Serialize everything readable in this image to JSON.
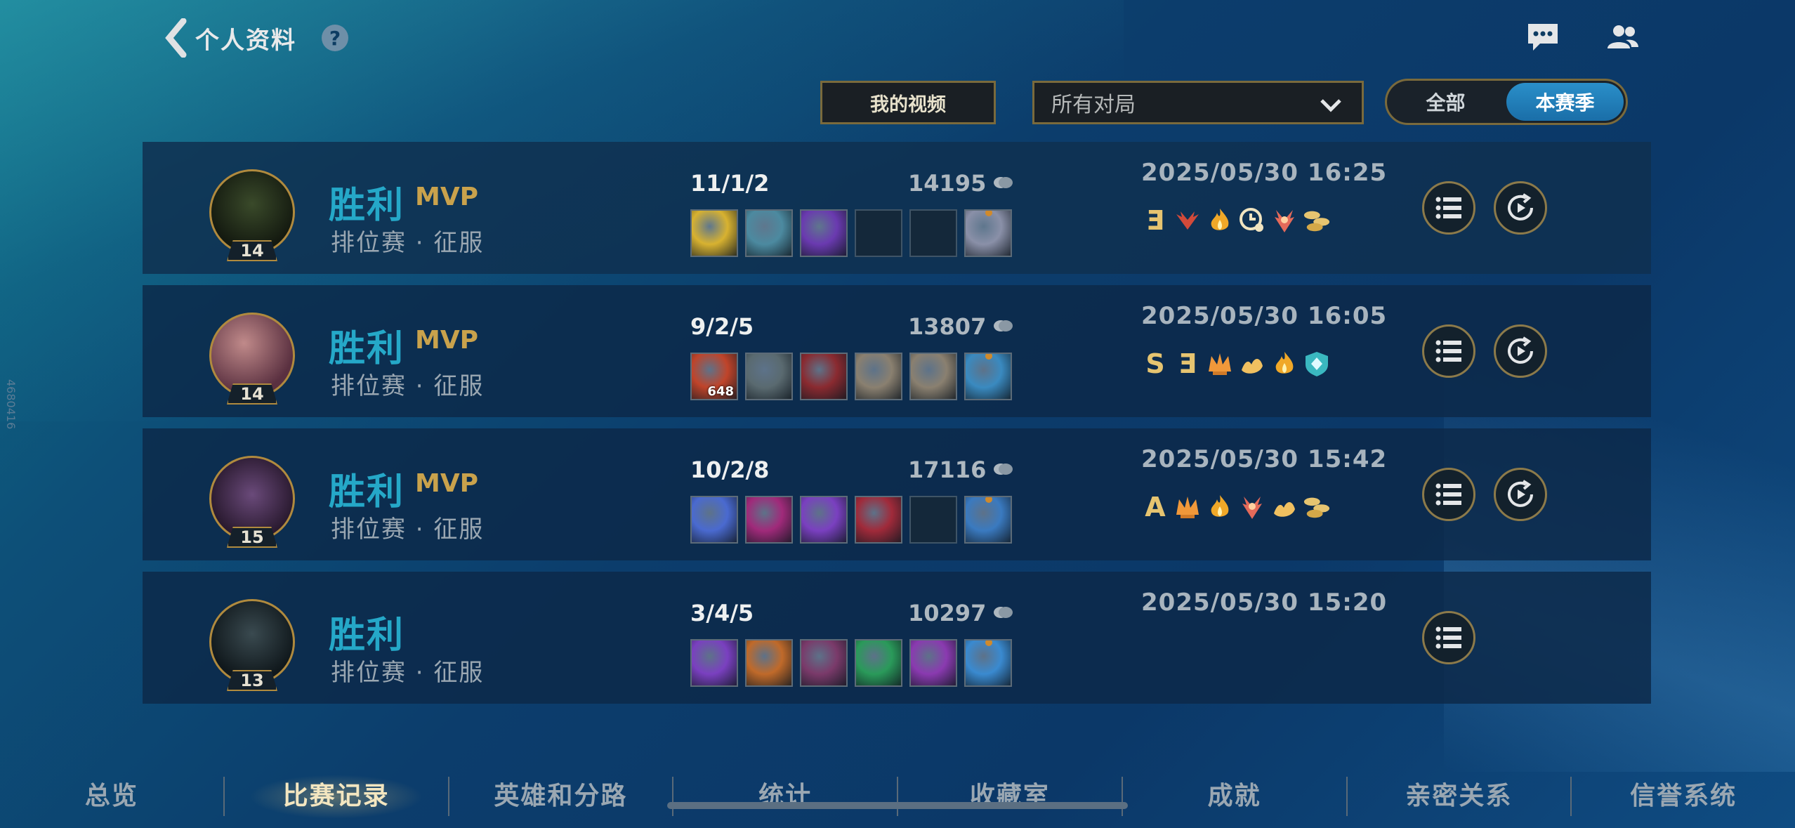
{
  "header": {
    "title": "个人资料",
    "help": "?"
  },
  "filters": {
    "videos_label": "我的视频",
    "match_type_selected": "所有对局",
    "season_options": [
      "全部",
      "本赛季"
    ],
    "season_selected": "本赛季"
  },
  "side_label": "4680416",
  "matches": [
    {
      "level": "14",
      "result": "胜利",
      "mvp": "MVP",
      "mode": "排位赛 · 征服",
      "kda": "11/1/2",
      "gold": "14195",
      "date": "2025/05/30 16:25",
      "badges": [
        "Ǝ",
        "wings",
        "flame",
        "clock",
        "wings2",
        "coins"
      ],
      "items": [
        {
          "color": "#d8b230"
        },
        {
          "color": "#4c8aa0"
        },
        {
          "color": "#6a3ab0"
        },
        {
          "color": ""
        },
        {
          "color": ""
        },
        {
          "color": "#8a90a8"
        }
      ]
    },
    {
      "level": "14",
      "result": "胜利",
      "mvp": "MVP",
      "mode": "排位赛 · 征服",
      "kda": "9/2/5",
      "gold": "13807",
      "date": "2025/05/30 16:05",
      "badges": [
        "S",
        "Ǝ",
        "crown",
        "hands",
        "flame",
        "shield"
      ],
      "items": [
        {
          "color": "#c0442a",
          "count": "648"
        },
        {
          "color": "#5a6a70"
        },
        {
          "color": "#8a2a30"
        },
        {
          "color": "#8a8070"
        },
        {
          "color": "#8a8070"
        },
        {
          "color": "#3a8ac0"
        }
      ]
    },
    {
      "level": "15",
      "result": "胜利",
      "mvp": "MVP",
      "mode": "排位赛 · 征服",
      "kda": "10/2/8",
      "gold": "17116",
      "date": "2025/05/30 15:42",
      "badges": [
        "A",
        "crown",
        "flame",
        "wings2",
        "hands",
        "coins"
      ],
      "items": [
        {
          "color": "#4a6ad0"
        },
        {
          "color": "#a02a7a"
        },
        {
          "color": "#7a40c0"
        },
        {
          "color": "#a02a3a"
        },
        {
          "color": ""
        },
        {
          "color": "#3a7ac0"
        }
      ]
    },
    {
      "level": "13",
      "result": "胜利",
      "mvp": "",
      "mode": "排位赛 · 征服",
      "kda": "3/4/5",
      "gold": "10297",
      "date": "2025/05/30 15:20",
      "badges": [],
      "items": [
        {
          "color": "#7a40c0"
        },
        {
          "color": "#c06a2a"
        },
        {
          "color": "#7a3a6a"
        },
        {
          "color": "#2a9a5a"
        },
        {
          "color": "#8a3ab0"
        },
        {
          "color": "#3a8ad0"
        }
      ]
    }
  ],
  "nav": [
    "总览",
    "比赛记录",
    "英雄和分路",
    "统计",
    "收藏室",
    "成就",
    "亲密关系",
    "信誉系统"
  ],
  "nav_active": "比赛记录",
  "colors": {
    "accent_result": "#25a8c8",
    "mvp_gold": "#c9a24c",
    "frame_gold": "#7a6a3c",
    "active_toggle": "#1a6ea8"
  }
}
